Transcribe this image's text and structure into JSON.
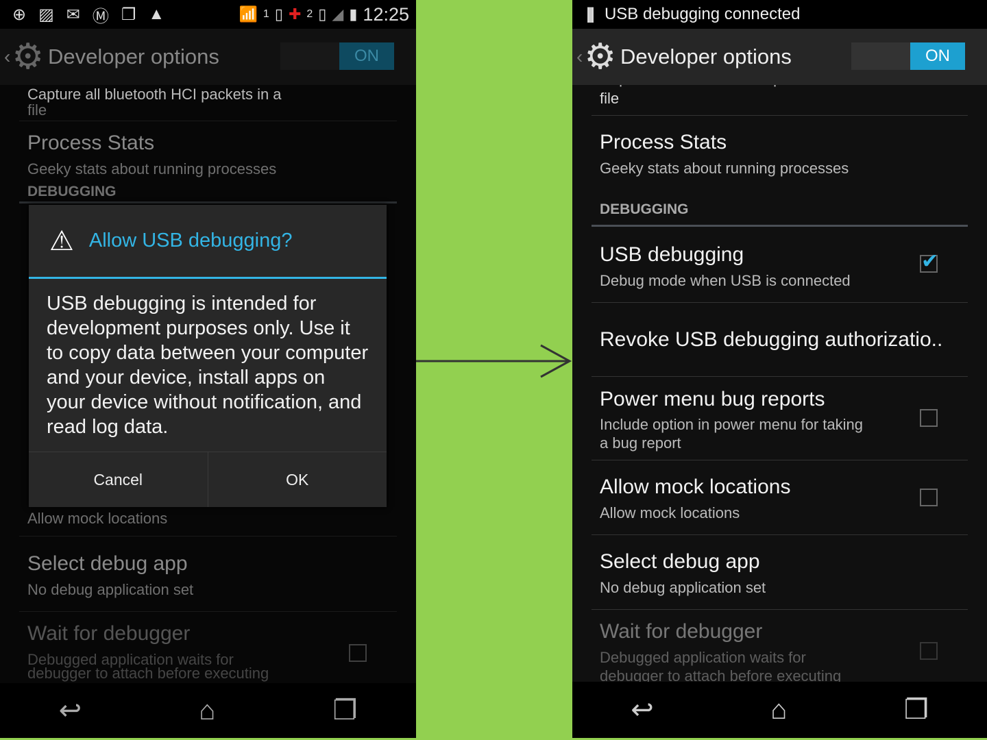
{
  "left": {
    "status": {
      "icons": [
        "add-icon",
        "image-icon",
        "messages-icon",
        "motorola-icon",
        "copy-icon",
        "triangle-app-icon",
        "wifi-icon",
        "sim1-icon",
        "red-cross-icon",
        "sim2-icon",
        "signal-icon",
        "battery-icon"
      ],
      "sim1": "1",
      "sim2": "2",
      "time": "12:25"
    },
    "action_bar": {
      "title": "Developer options",
      "switch": "ON"
    },
    "items": {
      "clipped": "Capture all bluetooth HCI packets in a",
      "file": "file",
      "process_title": "Process Stats",
      "process_sub": "Geeky stats about running processes",
      "section": "DEBUGGING",
      "mock_sub": "Allow mock locations",
      "debug_app_title": "Select debug app",
      "debug_app_sub": "No debug application set",
      "wait_title": "Wait for debugger",
      "wait_sub1": "Debugged application waits for",
      "wait_sub2": "debugger to attach before executing"
    },
    "dialog": {
      "title": "Allow USB debugging?",
      "message": "USB debugging is intended for development purposes only. Use it to copy data between your computer and your device, install apps on your device without notification, and read log data.",
      "cancel": "Cancel",
      "ok": "OK"
    }
  },
  "right": {
    "status": {
      "notification": "USB debugging connected"
    },
    "action_bar": {
      "title": "Developer options",
      "switch": "ON"
    },
    "items": {
      "clipped": "Capture all bluetooth HCI packets in a",
      "file": "file",
      "process_title": "Process Stats",
      "process_sub": "Geeky stats about running processes",
      "section": "DEBUGGING",
      "usb_title": "USB debugging",
      "usb_sub": "Debug mode when USB is connected",
      "usb_checked": true,
      "revoke_title": "Revoke USB debugging authorizatio..",
      "power_title": "Power menu bug reports",
      "power_sub1": "Include option in power menu for taking",
      "power_sub2": "a bug report",
      "power_checked": false,
      "mock_title": "Allow mock locations",
      "mock_sub": "Allow mock locations",
      "mock_checked": false,
      "debug_app_title": "Select debug app",
      "debug_app_sub": "No debug application set",
      "wait_title": "Wait for debugger",
      "wait_sub1": "Debugged application waits for",
      "wait_sub2": "debugger to attach before executing",
      "wait_checked": false
    }
  },
  "colors": {
    "background": "#92d050",
    "accent": "#33b5e5",
    "switch_on": "#1da0d0"
  }
}
